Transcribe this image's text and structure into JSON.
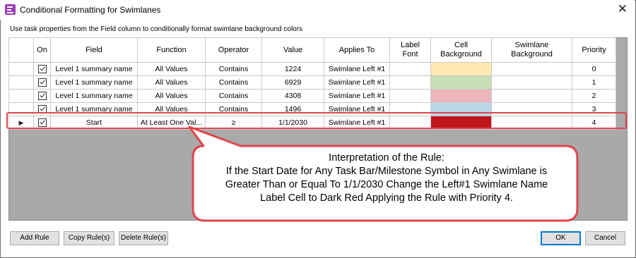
{
  "window": {
    "title": "Conditional Formatting for Swimlanes"
  },
  "hint": "Use task properties from the Field column to conditionally format swimlane background colors",
  "columns": [
    "On",
    "Field",
    "Function",
    "Operator",
    "Value",
    "Applies To",
    "Label Font",
    "Cell Background",
    "Swimlane Background",
    "Priority"
  ],
  "rows": [
    {
      "field": "Level 1 summary name",
      "function": "All Values",
      "operator": "Contains",
      "value": "1224",
      "applies_to": "Swimlane Left #1",
      "cell_color": "#fde9b1",
      "priority": "0"
    },
    {
      "field": "Level 1 summary name",
      "function": "All Values",
      "operator": "Contains",
      "value": "6929",
      "applies_to": "Swimlane Left #1",
      "cell_color": "#c6dfb5",
      "priority": "1"
    },
    {
      "field": "Level 1 summary name",
      "function": "All Values",
      "operator": "Contains",
      "value": "4308",
      "applies_to": "Swimlane Left #1",
      "cell_color": "#eeb7bd",
      "priority": "2"
    },
    {
      "field": "Level 1 summary name",
      "function": "All Values",
      "operator": "Contains",
      "value": "1496",
      "applies_to": "Swimlane Left #1",
      "cell_color": "#bad7ea",
      "priority": "3"
    },
    {
      "field": "Start",
      "function": "At Least One Val...",
      "operator": "≥",
      "value": "1/1/2030",
      "applies_to": "Swimlane Left #1",
      "cell_color": "#c1151c",
      "priority": "4",
      "current": true
    }
  ],
  "callout": {
    "lines": [
      "Interpretation of the Rule:",
      "If the Start Date for Any Task Bar/Milestone Symbol in Any Swimlane is",
      "Greater Than or Equal To 1/1/2030 Change the Left#1 Swimlane Name",
      "Label Cell to Dark Red Applying the Rule with Priority 4."
    ],
    "border_color": "#e0454d"
  },
  "buttons": {
    "add_rule": "Add Rule",
    "copy_rules": "Copy Rule(s)",
    "delete_rules": "Delete Rule(s)",
    "ok": "OK",
    "cancel": "Cancel"
  }
}
